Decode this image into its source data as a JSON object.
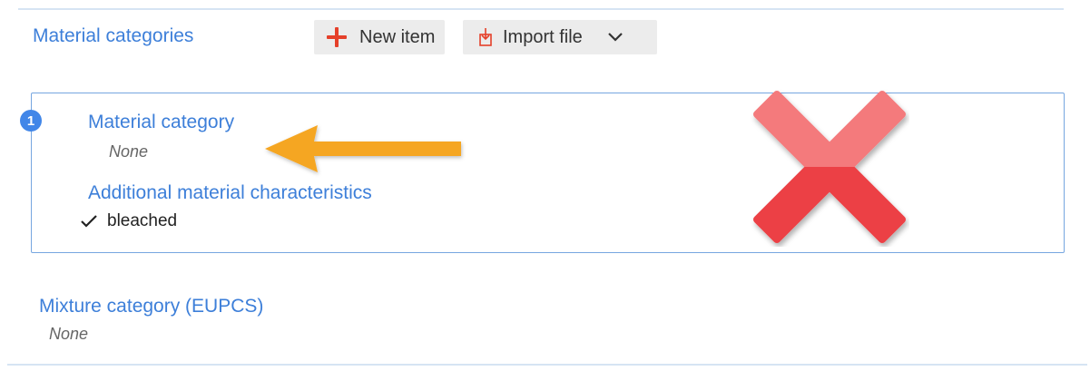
{
  "section": {
    "title": "Material categories",
    "new_item_label": "New item",
    "import_file_label": "Import file"
  },
  "card": {
    "badge": "1",
    "material_category_label": "Material category",
    "material_category_value": "None",
    "additional_label": "Additional material characteristics",
    "additional_items": [
      "bleached"
    ]
  },
  "mixture": {
    "label": "Mixture category (EUPCS)",
    "value": "None"
  },
  "colors": {
    "accent_blue": "#3d7fd9",
    "plus_red": "#e5402a",
    "arrow_orange": "#f5a623",
    "x_red": "#f0474a"
  },
  "annotations": {
    "arrow": "arrow-left-icon",
    "x_mark": "red-x-icon"
  }
}
